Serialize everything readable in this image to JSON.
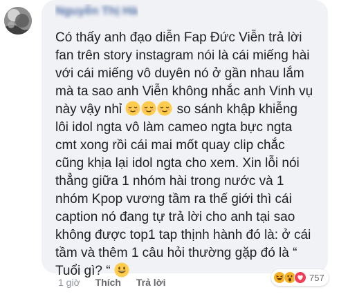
{
  "comment": {
    "author": "Nguyễn Thị Hà",
    "lines": [
      "Có thấy anh đạo diễn Fap Đức Viễn trả lời",
      "fan trên story instagram nói là cái miếng hài",
      "với cái miếng vô duyên nó ở gần nhau lắm",
      "mà ta sao anh Viễn không nhắc anh Vinh vụ",
      " so sánh khập khiễng",
      "lôi idol ngta vô làm cameo ngta bực ngta",
      "cmt xong rồi cái mai mốt quay clip chắc",
      "cũng khịa lại idol ngta cho xem. Xin lỗi nói",
      "thẳng giữa 1 nhóm hài trong nước và 1",
      "nhóm Kpop vương tầm ra thế giới thì cái",
      "caption nó đang tự trả lời cho anh tại sao",
      "không được top1 tap thịnh hành đó là: ở cái",
      "tầm và thêm 1 câu hỏi thường gặp đó là “",
      "Tuổi gì? “"
    ],
    "line5_prefix": "này vậy nhỉ",
    "emojis": {
      "line5": [
        "relieved-emoji",
        "relieved-emoji",
        "relieved-emoji"
      ],
      "last_line": [
        "grinning-emoji"
      ]
    }
  },
  "footer": {
    "time": "1 giờ",
    "like_label": "Thích",
    "reply_label": "Trả lời"
  },
  "reactions": {
    "icons": [
      "laugh-reaction-icon",
      "wow-reaction-icon",
      "love-reaction-icon"
    ],
    "count": "757",
    "colors": {
      "laugh": "#f7b125",
      "wow": "#f7b125",
      "love": "#f33e58"
    }
  },
  "colors": {
    "bubble": "#f0f2f5",
    "text": "#1c1e21",
    "meta": "#65676b"
  }
}
